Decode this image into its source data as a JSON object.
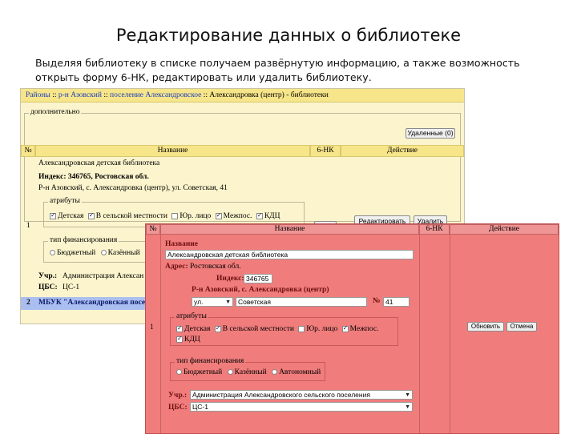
{
  "slide": {
    "title": "Редактирование данных о библиотеке",
    "description": "Выделяя библиотеку в списке получаем развёрнутую информацию, а также возможность открыть форму 6-НК, редактировать или удалить библиотеку."
  },
  "breadcrumb": {
    "items": [
      "Районы",
      "р-н Азовский",
      "поселение Александровское",
      "Александровка (центр)"
    ],
    "separator": " :: ",
    "current": " - библиотеки"
  },
  "list_window": {
    "section_legend": "дополнительно",
    "deleted_button": "Удаленные (0)",
    "columns": [
      "№",
      "Название",
      "6-НК",
      "Действие"
    ],
    "rows": [
      {
        "num": "1",
        "name": "Александровская детская библиотека",
        "index": "Индекс: 346765, Ростовская обл.",
        "address": "Р-н Азовский, с. Александровка (центр), ул. Советская, 41",
        "attributes_legend": "атрибуты",
        "attributes": [
          {
            "label": "Детская",
            "checked": true
          },
          {
            "label": "В сельской местности",
            "checked": true
          },
          {
            "label": "Юр. лицо",
            "checked": false
          },
          {
            "label": "Межпос.",
            "checked": true
          },
          {
            "label": "КДЦ",
            "checked": true
          }
        ],
        "financing_legend": "тип финансирования",
        "financing": [
          "Бюджетный",
          "Казённый"
        ],
        "uchr_label": "Учр.:",
        "uchr_value": "Администрация Алексан",
        "cbs_label": "ЦБС:",
        "cbs_value": "ЦС-1",
        "edit_button": "Редактировать",
        "delete_button": "Удалить",
        "nk_button": "6-НК"
      },
      {
        "num": "2",
        "name": "МБУК \"Александровская посе"
      }
    ]
  },
  "edit_form": {
    "columns": [
      "№",
      "Название",
      "6-НК",
      "Действие"
    ],
    "row_num": "1",
    "name_label": "Название",
    "name_value": "Александровская детская библиотека",
    "address_label": "Адрес:",
    "address_value": "Ростовская обл.",
    "index_label": "Индекс:",
    "index_value": "346765",
    "locality_value": "Р-н Азовский, с. Александровка (центр)",
    "street_type": "ул.",
    "street_name": "Советская",
    "house_label": "№",
    "house_value": "41",
    "attributes_legend": "атрибуты",
    "attributes": [
      {
        "label": "Детская",
        "checked": true
      },
      {
        "label": "В сельской местности",
        "checked": true
      },
      {
        "label": "Юр. лицо",
        "checked": false
      },
      {
        "label": "Межпос.",
        "checked": true
      },
      {
        "label": "КДЦ",
        "checked": true
      }
    ],
    "financing_legend": "тип финансирования",
    "financing": [
      "Бюджетный",
      "Казённый",
      "Автономный"
    ],
    "uchr_label": "Учр.:",
    "uchr_value": "Администрация Александровского сельского поселения",
    "cbs_label": "ЦБС:",
    "cbs_value": "ЦС-1",
    "update_button": "Обновить",
    "cancel_button": "Отмена"
  }
}
